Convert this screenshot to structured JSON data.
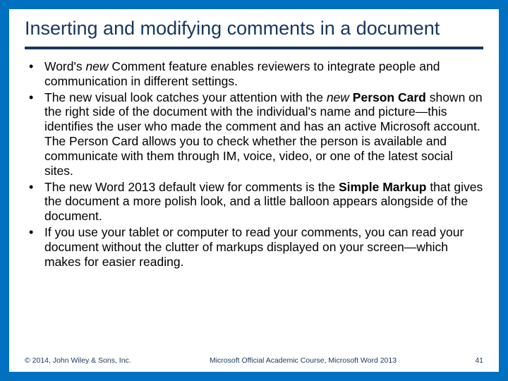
{
  "title": "Inserting and modifying comments in a document",
  "bullets": [
    {
      "pre": "Word's ",
      "em1": "new",
      "mid": " Comment feature enables reviewers to integrate people and communication in different settings.",
      "bold1": "",
      "post": ""
    },
    {
      "pre": "The new visual look catches your attention with the ",
      "em1": "new",
      "mid": " ",
      "bold1": "Person Card",
      "post": " shown on the right side of the document with the individual's name and picture—this identifies the user who made the comment and has an active Microsoft account. The Person Card allows you to check whether the person is available and communicate with them through IM, voice, video, or one of the latest social sites."
    },
    {
      "pre": "The new Word 2013 default view for comments is the ",
      "em1": "",
      "mid": "",
      "bold1": "Simple Markup",
      "post": " that gives the document a more polish look, and a little balloon appears alongside of the document."
    },
    {
      "pre": "If you use your tablet or computer to read your comments, you can read your document without the clutter of markups displayed on your screen—which makes for easier reading.",
      "em1": "",
      "mid": "",
      "bold1": "",
      "post": ""
    }
  ],
  "footer": {
    "copyright": "© 2014, John Wiley & Sons, Inc.",
    "course": "Microsoft Official Academic Course, Microsoft Word 2013",
    "page": "41"
  }
}
